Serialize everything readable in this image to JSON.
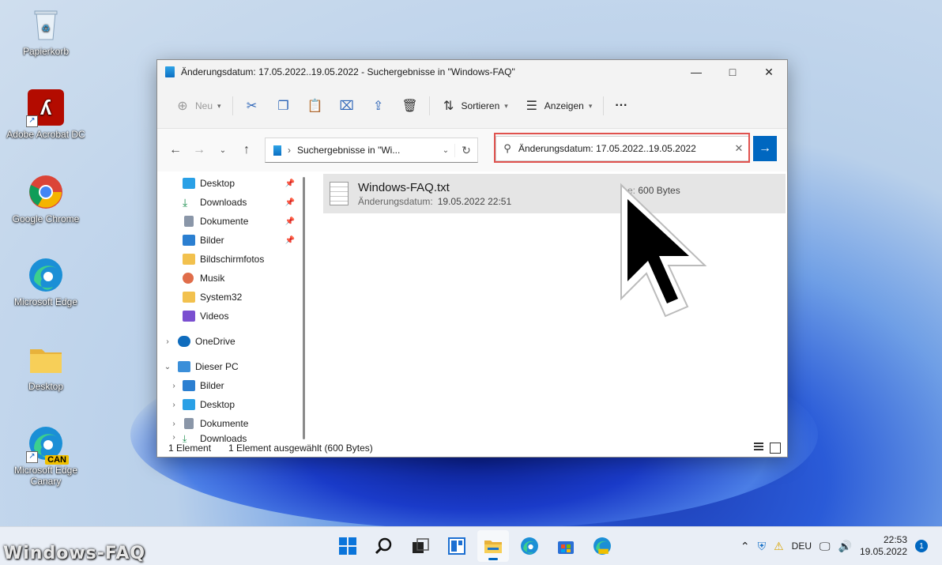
{
  "desktop": {
    "icons": [
      {
        "label": "Papierkorb",
        "icon": "recycle-bin-icon"
      },
      {
        "label": "Adobe Acrobat DC",
        "icon": "acrobat-icon"
      },
      {
        "label": "Google Chrome",
        "icon": "chrome-icon"
      },
      {
        "label": "Microsoft Edge",
        "icon": "edge-icon"
      },
      {
        "label": "Desktop",
        "icon": "folder-icon"
      },
      {
        "label": "Microsoft Edge Canary",
        "icon": "edge-canary-icon",
        "badge": "CAN"
      }
    ]
  },
  "window": {
    "title": "Änderungsdatum: 17.05.2022..19.05.2022 - Suchergebnisse in \"Windows-FAQ\"",
    "toolbar": {
      "new_label": "Neu",
      "sort_label": "Sortieren",
      "view_label": "Anzeigen",
      "more_label": "···"
    },
    "address": {
      "crumb": "Suchergebnisse in \"Wi..."
    },
    "search": {
      "value": "Änderungsdatum: 17.05.2022..19.05.2022"
    },
    "sidebar": {
      "quick_access": [
        {
          "label": "Desktop",
          "pinned": true,
          "color": "#2aa0e6"
        },
        {
          "label": "Downloads",
          "pinned": true,
          "color": "#1c8f4f"
        },
        {
          "label": "Dokumente",
          "pinned": true,
          "color": "#8a96a8"
        },
        {
          "label": "Bilder",
          "pinned": true,
          "color": "#2b7fd1"
        },
        {
          "label": "Bildschirmfotos",
          "pinned": false,
          "color": "#f2c14e"
        },
        {
          "label": "Musik",
          "pinned": false,
          "color": "#e06d4a"
        },
        {
          "label": "System32",
          "pinned": false,
          "color": "#f2c14e"
        },
        {
          "label": "Videos",
          "pinned": false,
          "color": "#7a4fd0"
        }
      ],
      "onedrive": "OneDrive",
      "this_pc": "Dieser PC",
      "pc_items": [
        "Bilder",
        "Desktop",
        "Dokumente",
        "Downloads"
      ]
    },
    "file": {
      "name": "Windows-FAQ.txt",
      "date_label": "Änderungsdatum:",
      "date_value": "19.05.2022 22:51",
      "size_label": "e:",
      "size_value": "600 Bytes"
    },
    "status": {
      "count": "1 Element",
      "selected": "1 Element ausgewählt (600 Bytes)"
    }
  },
  "taskbar": {
    "apps": [
      "start-icon",
      "search-icon",
      "task-view-icon",
      "widgets-icon",
      "file-explorer-icon",
      "edge-icon",
      "store-icon",
      "edge-canary-icon"
    ],
    "language": "DEU",
    "time": "22:53",
    "date": "19.05.2022",
    "notifications": "1"
  },
  "watermark": "Windows-FAQ"
}
